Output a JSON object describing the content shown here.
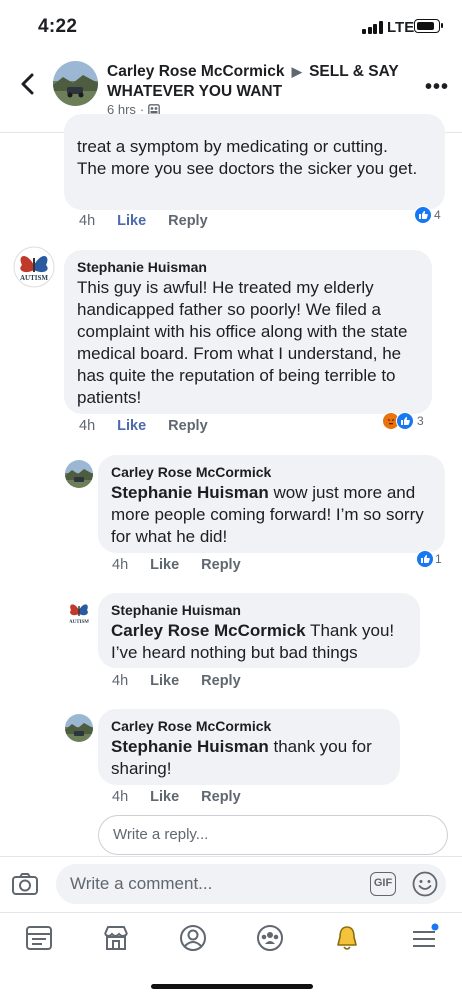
{
  "status": {
    "time": "4:22",
    "network": "LTE"
  },
  "header": {
    "poster": "Carley Rose McCormick",
    "arrow": "▶",
    "group": "SELL & SAY WHATEVER YOU WANT",
    "time": "6 hrs",
    "sep": "·",
    "more": "•••"
  },
  "comments": [
    {
      "text_line1": "treat a symptom by medicating or cutting.",
      "text_rest": "The more you see doctors the sicker you get.",
      "time": "4h",
      "like": "Like",
      "reply": "Reply",
      "reactions": "4"
    },
    {
      "author": "Stephanie Huisman",
      "avatar_text": "AUTISM",
      "text": "This guy is awful! He treated my elderly handicapped father so poorly! We filed a complaint with his office along with the state medical board. From what I understand, he has quite the reputation of being terrible to patients!",
      "time": "4h",
      "like": "Like",
      "reply": "Reply",
      "reactions": "3"
    },
    {
      "author": "Carley Rose McCormick",
      "tag": "Stephanie Huisman",
      "text": " wow just more and more people coming forward! I’m so sorry for what he did!",
      "time": "4h",
      "like": "Like",
      "reply": "Reply",
      "reactions": "1"
    },
    {
      "author": "Stephanie Huisman",
      "avatar_text": "AUTISM",
      "tag": "Carley Rose McCormick",
      "text": " Thank you! I’ve heard nothing but bad things",
      "time": "4h",
      "like": "Like",
      "reply": "Reply"
    },
    {
      "author": "Carley Rose McCormick",
      "tag": "Stephanie Huisman",
      "text": " thank you for sharing!",
      "time": "4h",
      "like": "Like",
      "reply": "Reply"
    }
  ],
  "reply_placeholder": "Write a reply...",
  "composer": {
    "placeholder": "Write a comment...",
    "gif": "GIF"
  },
  "colors": {
    "accent": "#1877f2",
    "like_link": "#4b6bad",
    "bubble": "#f0f2f5",
    "angry": "#e9710f"
  },
  "nav_icons": [
    "news-feed-icon",
    "marketplace-icon",
    "profile-icon",
    "groups-icon",
    "notifications-icon",
    "menu-icon"
  ]
}
